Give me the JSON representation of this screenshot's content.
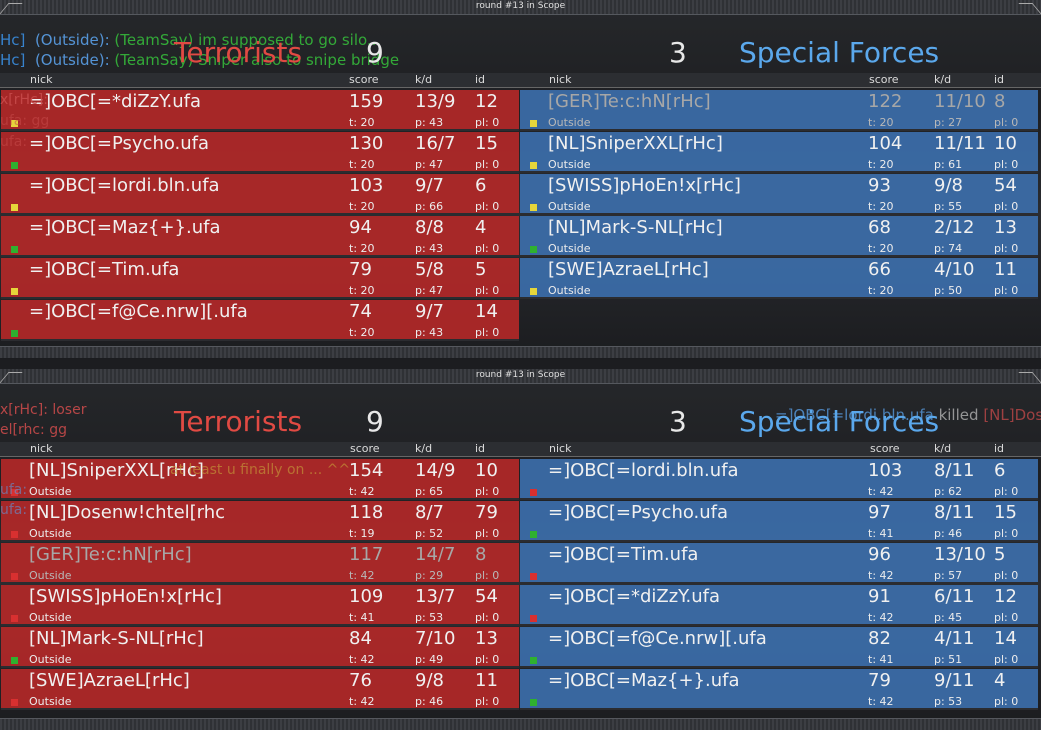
{
  "colors": {
    "terrorists": "#e14a43",
    "special_forces": "#5ba8ec",
    "dot_yellow": "#e6d63a",
    "dot_green": "#2fb12f",
    "dot_red": "#d83030"
  },
  "top": {
    "round": "round #13 in Scope",
    "chat": [
      {
        "who": "Hc]",
        "ctx": "(Outside):",
        "msg": "(TeamSay) im supposed to go silo..."
      },
      {
        "who": "Hc]",
        "ctx": "(Outside):",
        "msg": "(TeamSay) Sniper also to snipe bridge"
      }
    ],
    "side_chat": [
      "x[rHc]:",
      "ufa: gg",
      "ufa:"
    ],
    "t_name": "Terrorists",
    "t_score": "9",
    "ct_name": "Special Forces",
    "ct_score": "3",
    "headers": {
      "nick": "nick",
      "score": "score",
      "kd": "k/d",
      "id": "id"
    },
    "t_players": [
      {
        "nick": "=]OBC[=*diZzY.ufa",
        "score": "159",
        "kd": "13/9",
        "id": "12",
        "t": "t: 20",
        "p": "p: 43",
        "pl": "pl: 0",
        "dot": "yellow",
        "status": ""
      },
      {
        "nick": "=]OBC[=Psycho.ufa",
        "score": "130",
        "kd": "16/7",
        "id": "15",
        "t": "t: 20",
        "p": "p: 47",
        "pl": "pl: 0",
        "dot": "green",
        "status": ""
      },
      {
        "nick": "=]OBC[=lordi.bln.ufa",
        "score": "103",
        "kd": "9/7",
        "id": "6",
        "t": "t: 20",
        "p": "p: 66",
        "pl": "pl: 0",
        "dot": "yellow",
        "status": ""
      },
      {
        "nick": "=]OBC[=Maz{+}.ufa",
        "score": "94",
        "kd": "8/8",
        "id": "4",
        "t": "t: 20",
        "p": "p: 43",
        "pl": "pl: 0",
        "dot": "green",
        "status": ""
      },
      {
        "nick": "=]OBC[=Tim.ufa",
        "score": "79",
        "kd": "5/8",
        "id": "5",
        "t": "t: 20",
        "p": "p: 47",
        "pl": "pl: 0",
        "dot": "yellow",
        "status": ""
      },
      {
        "nick": "=]OBC[=f@Ce.nrw][.ufa",
        "score": "74",
        "kd": "9/7",
        "id": "14",
        "t": "t: 20",
        "p": "p: 43",
        "pl": "pl: 0",
        "dot": "green",
        "status": ""
      }
    ],
    "ct_players": [
      {
        "nick": "[GER]Te:c:hN[rHc]",
        "score": "122",
        "kd": "11/10",
        "id": "8",
        "t": "t: 20",
        "p": "p: 27",
        "pl": "pl: 0",
        "dot": "yellow",
        "status": "Outside",
        "dim": true
      },
      {
        "nick": "[NL]SniperXXL[rHc]",
        "score": "104",
        "kd": "11/11",
        "id": "10",
        "t": "t: 20",
        "p": "p: 61",
        "pl": "pl: 0",
        "dot": "yellow",
        "status": "Outside"
      },
      {
        "nick": "[SWISS]pHoEn!x[rHc]",
        "score": "93",
        "kd": "9/8",
        "id": "54",
        "t": "t: 20",
        "p": "p: 55",
        "pl": "pl: 0",
        "dot": "yellow",
        "status": "Outside"
      },
      {
        "nick": "[NL]Mark-S-NL[rHc]",
        "score": "68",
        "kd": "2/12",
        "id": "13",
        "t": "t: 20",
        "p": "p: 74",
        "pl": "pl: 0",
        "dot": "green",
        "status": "Outside"
      },
      {
        "nick": "[SWE]AzraeL[rHc]",
        "score": "66",
        "kd": "4/10",
        "id": "11",
        "t": "t: 20",
        "p": "p: 50",
        "pl": "pl: 0",
        "dot": "yellow",
        "status": "Outside"
      }
    ]
  },
  "bottom": {
    "round": "round #13 in Scope",
    "side_chat": [
      "x[rHc]: loser",
      "el[rhc: gg",
      "ufa:",
      "ufa:"
    ],
    "kill_feed": {
      "killer": "=]OBC[=lordi.bln.ufa",
      "verb": "killed",
      "victim": "[NL]Dosenw!chtel"
    },
    "overlay_chat": "at least u finally on ... ^^",
    "t_name": "Terrorists",
    "t_score": "9",
    "ct_name": "Special Forces",
    "ct_score": "3",
    "headers": {
      "nick": "nick",
      "score": "score",
      "kd": "k/d",
      "id": "id"
    },
    "t_players": [
      {
        "nick": "[NL]SniperXXL[rHc]",
        "score": "154",
        "kd": "14/9",
        "id": "10",
        "t": "t: 42",
        "p": "p: 65",
        "pl": "pl: 0",
        "dot": "red",
        "status": "Outside"
      },
      {
        "nick": "[NL]Dosenw!chtel[rhc",
        "score": "118",
        "kd": "8/7",
        "id": "79",
        "t": "t: 19",
        "p": "p: 52",
        "pl": "pl: 0",
        "dot": "red",
        "status": "Outside"
      },
      {
        "nick": "[GER]Te:c:hN[rHc]",
        "score": "117",
        "kd": "14/7",
        "id": "8",
        "t": "t: 42",
        "p": "p: 29",
        "pl": "pl: 0",
        "dot": "red",
        "status": "Outside",
        "dim": true
      },
      {
        "nick": "[SWISS]pHoEn!x[rHc]",
        "score": "109",
        "kd": "13/7",
        "id": "54",
        "t": "t: 41",
        "p": "p: 53",
        "pl": "pl: 0",
        "dot": "red",
        "status": "Outside"
      },
      {
        "nick": "[NL]Mark-S-NL[rHc]",
        "score": "84",
        "kd": "7/10",
        "id": "13",
        "t": "t: 42",
        "p": "p: 49",
        "pl": "pl: 0",
        "dot": "green",
        "status": "Outside"
      },
      {
        "nick": "[SWE]AzraeL[rHc]",
        "score": "76",
        "kd": "9/8",
        "id": "11",
        "t": "t: 42",
        "p": "p: 46",
        "pl": "pl: 0",
        "dot": "red",
        "status": "Outside"
      }
    ],
    "ct_players": [
      {
        "nick": "=]OBC[=lordi.bln.ufa",
        "score": "103",
        "kd": "8/11",
        "id": "6",
        "t": "t: 42",
        "p": "p: 62",
        "pl": "pl: 0",
        "dot": "red",
        "status": ""
      },
      {
        "nick": "=]OBC[=Psycho.ufa",
        "score": "97",
        "kd": "8/11",
        "id": "15",
        "t": "t: 41",
        "p": "p: 46",
        "pl": "pl: 0",
        "dot": "green",
        "status": ""
      },
      {
        "nick": "=]OBC[=Tim.ufa",
        "score": "96",
        "kd": "13/10",
        "id": "5",
        "t": "t: 42",
        "p": "p: 57",
        "pl": "pl: 0",
        "dot": "red",
        "status": ""
      },
      {
        "nick": "=]OBC[=*diZzY.ufa",
        "score": "91",
        "kd": "6/11",
        "id": "12",
        "t": "t: 42",
        "p": "p: 45",
        "pl": "pl: 0",
        "dot": "red",
        "status": ""
      },
      {
        "nick": "=]OBC[=f@Ce.nrw][.ufa",
        "score": "82",
        "kd": "4/11",
        "id": "14",
        "t": "t: 41",
        "p": "p: 51",
        "pl": "pl: 0",
        "dot": "green",
        "status": ""
      },
      {
        "nick": "=]OBC[=Maz{+}.ufa",
        "score": "79",
        "kd": "9/11",
        "id": "4",
        "t": "t: 42",
        "p": "p: 53",
        "pl": "pl: 0",
        "dot": "green",
        "status": ""
      }
    ]
  }
}
